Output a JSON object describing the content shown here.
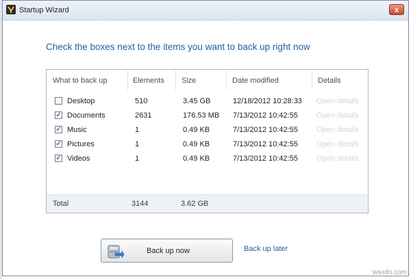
{
  "window": {
    "title": "Startup Wizard",
    "close_label": "x"
  },
  "heading": "Check the boxes next to the items you want to back up right now",
  "table": {
    "columns": [
      "What to back up",
      "Elements",
      "Size",
      "Date modified",
      "Details"
    ],
    "rows": [
      {
        "name": "Desktop",
        "checked": false,
        "elements": "510",
        "size": "3.45 GB",
        "date": "12/18/2012 10:28:33",
        "details": "Open details"
      },
      {
        "name": "Documents",
        "checked": true,
        "elements": "2631",
        "size": "176.53 MB",
        "date": "7/13/2012 10:42:55",
        "details": "Open details"
      },
      {
        "name": "Music",
        "checked": true,
        "elements": "1",
        "size": "0.49 KB",
        "date": "7/13/2012 10:42:55",
        "details": "Open details"
      },
      {
        "name": "Pictures",
        "checked": true,
        "elements": "1",
        "size": "0.49 KB",
        "date": "7/13/2012 10:42:55",
        "details": "Open details"
      },
      {
        "name": "Videos",
        "checked": true,
        "elements": "1",
        "size": "0.49 KB",
        "date": "7/13/2012 10:42:55",
        "details": "Open details"
      }
    ],
    "total": {
      "label": "Total",
      "elements": "3144",
      "size": "3.62 GB"
    }
  },
  "buttons": {
    "backup_now": "Back up now",
    "backup_later": "Back up later"
  },
  "watermark": "wsxdn.com",
  "icons": {
    "app": "app-logo-icon",
    "backup": "backup-drive-icon",
    "close": "close-icon"
  },
  "colors": {
    "accent": "#1f5f9f",
    "disabled_link": "#cfd6df"
  }
}
